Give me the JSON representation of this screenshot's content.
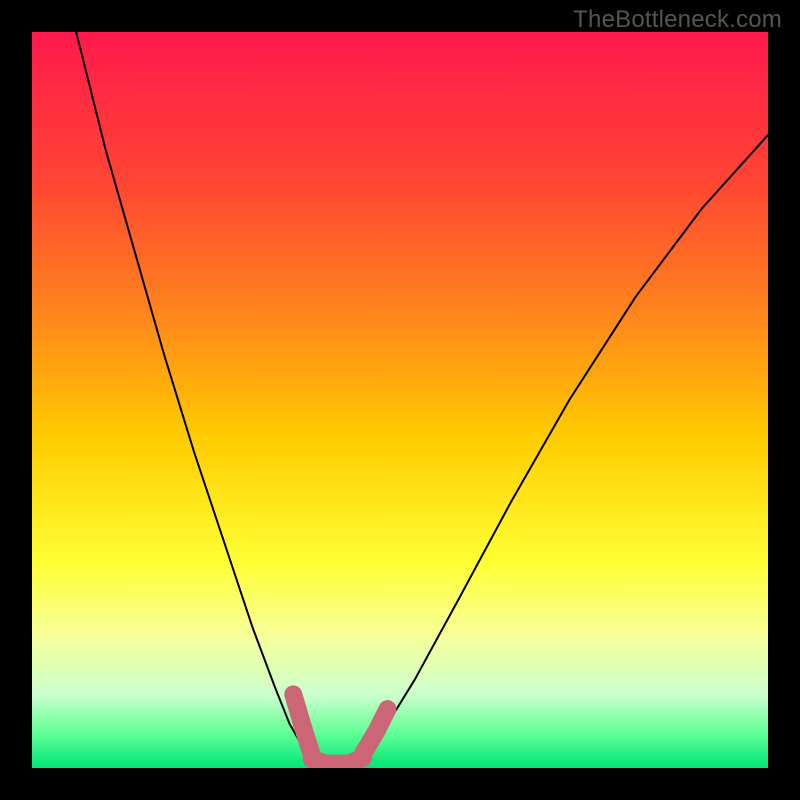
{
  "watermark": "TheBottleneck.com",
  "chart_data": {
    "type": "line",
    "title": "",
    "xlabel": "",
    "ylabel": "",
    "xlim": [
      0,
      1
    ],
    "ylim": [
      0,
      1
    ],
    "gradient_stops": [
      {
        "t": 0.0,
        "color": "#ff1a4d"
      },
      {
        "t": 0.2,
        "color": "#ff4433"
      },
      {
        "t": 0.4,
        "color": "#ff8c1a"
      },
      {
        "t": 0.55,
        "color": "#ffcc00"
      },
      {
        "t": 0.72,
        "color": "#ffff33"
      },
      {
        "t": 0.82,
        "color": "#f7ff99"
      },
      {
        "t": 0.9,
        "color": "#ccffcc"
      },
      {
        "t": 0.95,
        "color": "#66ff99"
      },
      {
        "t": 1.0,
        "color": "#00e676"
      }
    ],
    "series": [
      {
        "name": "left-branch",
        "stroke": "#000000",
        "width": 2,
        "x": [
          0.06,
          0.1,
          0.14,
          0.18,
          0.22,
          0.26,
          0.3,
          0.33,
          0.35,
          0.37,
          0.382
        ],
        "y": [
          1.0,
          0.84,
          0.7,
          0.56,
          0.43,
          0.31,
          0.19,
          0.11,
          0.06,
          0.025,
          0.01
        ]
      },
      {
        "name": "floor",
        "stroke": "#000000",
        "width": 2,
        "x": [
          0.382,
          0.395,
          0.41,
          0.43,
          0.448
        ],
        "y": [
          0.01,
          0.004,
          0.002,
          0.004,
          0.01
        ]
      },
      {
        "name": "right-branch",
        "stroke": "#000000",
        "width": 2,
        "x": [
          0.448,
          0.48,
          0.52,
          0.58,
          0.65,
          0.73,
          0.82,
          0.91,
          1.0
        ],
        "y": [
          0.01,
          0.055,
          0.12,
          0.23,
          0.36,
          0.5,
          0.64,
          0.76,
          0.86
        ]
      },
      {
        "name": "bottom-left-overlay",
        "stroke": "#cc6677",
        "width": 18,
        "x": [
          0.355,
          0.368,
          0.38
        ],
        "y": [
          0.1,
          0.056,
          0.018
        ]
      },
      {
        "name": "bottom-mid-overlay",
        "stroke": "#cc6677",
        "width": 18,
        "x": [
          0.38,
          0.4,
          0.43,
          0.45
        ],
        "y": [
          0.012,
          0.006,
          0.006,
          0.014
        ]
      },
      {
        "name": "bottom-right-overlay",
        "stroke": "#cc6677",
        "width": 18,
        "x": [
          0.45,
          0.468,
          0.483
        ],
        "y": [
          0.02,
          0.05,
          0.08
        ]
      }
    ]
  }
}
